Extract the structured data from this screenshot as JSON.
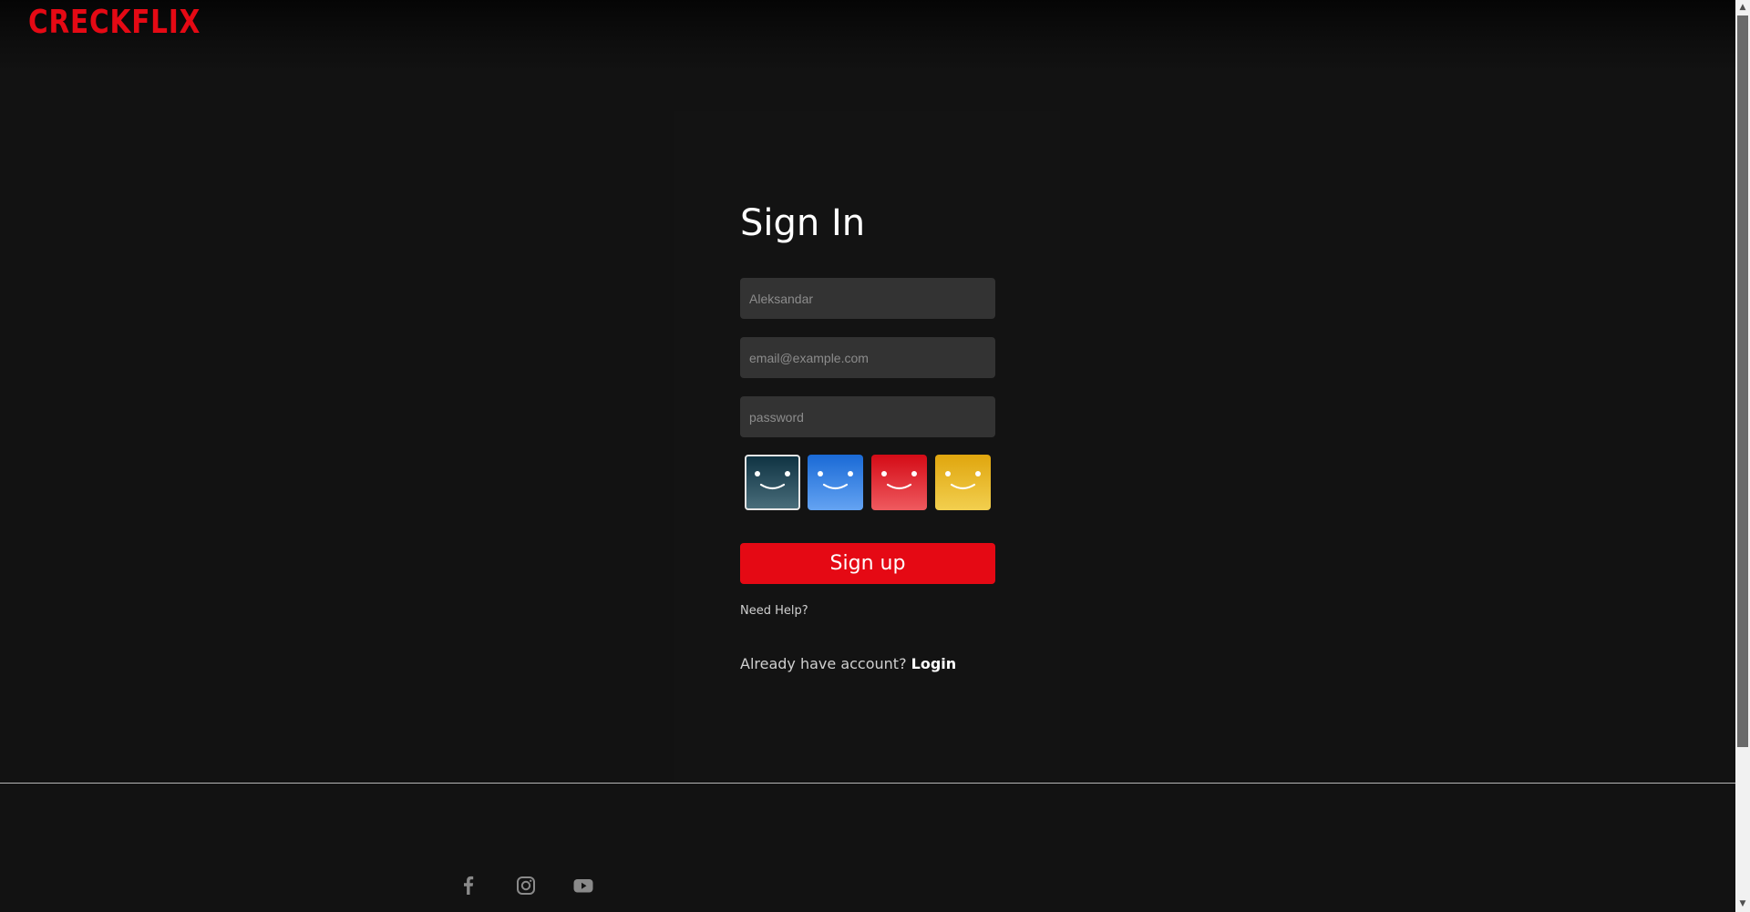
{
  "brand": {
    "logo_text": "CRECKFLIX",
    "color": "#e50914"
  },
  "form": {
    "title": "Sign In",
    "name_placeholder": "Aleksandar",
    "email_placeholder": "email@example.com",
    "password_placeholder": "password",
    "submit_label": "Sign up",
    "help_label": "Need Help?",
    "already_text": "Already have account?",
    "login_label": "Login"
  },
  "avatars": [
    {
      "color_top": "#0d3141",
      "color_bottom": "#4b6f7c",
      "selected": true
    },
    {
      "color_top": "#1a6ad6",
      "color_bottom": "#64a3f2",
      "selected": false
    },
    {
      "color_top": "#d40b16",
      "color_bottom": "#ef5a5f",
      "selected": false
    },
    {
      "color_top": "#e0a60e",
      "color_bottom": "#f2cf4f",
      "selected": false
    }
  ],
  "footer": {
    "social_icons": [
      "facebook-icon",
      "instagram-icon",
      "youtube-icon"
    ]
  }
}
